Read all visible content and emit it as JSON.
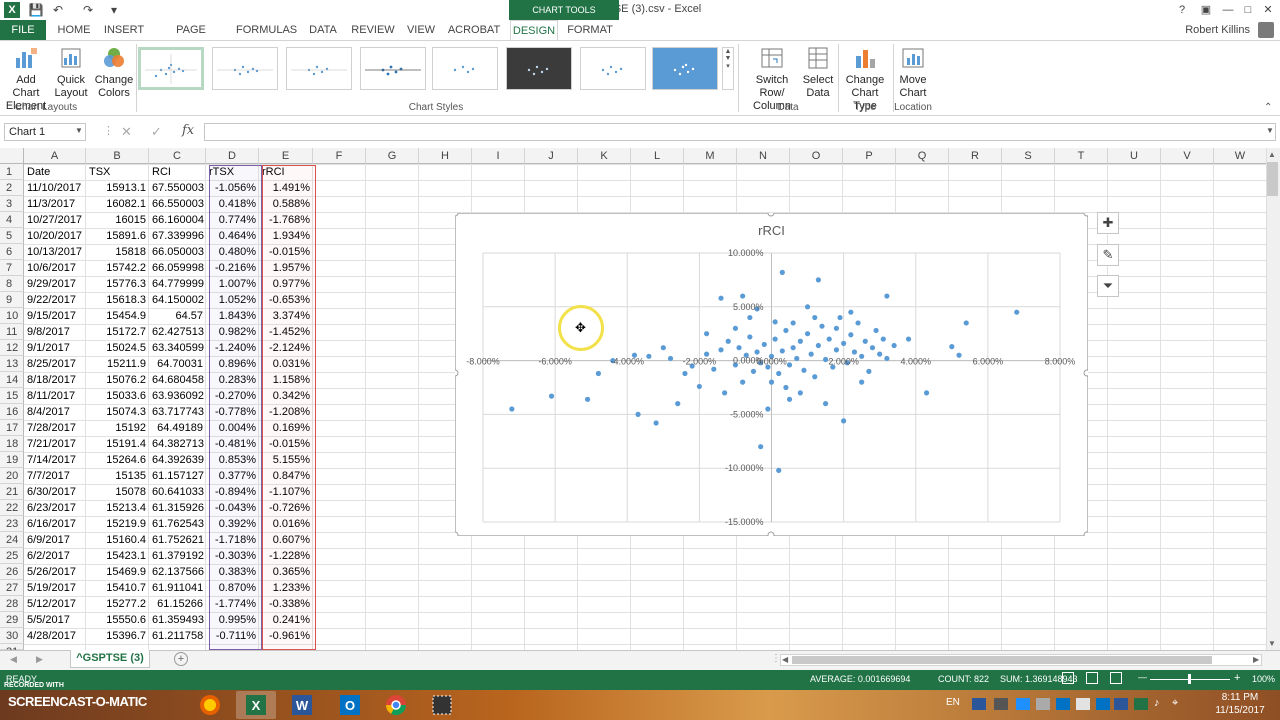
{
  "window": {
    "title": "^GSPTSE (3).csv - Excel",
    "context_tab_group": "CHART TOOLS",
    "help": "?",
    "minimize": "—",
    "restore": "□",
    "close": "✕"
  },
  "tabs": [
    "FILE",
    "HOME",
    "INSERT",
    "PAGE LAYOUT",
    "FORMULAS",
    "DATA",
    "REVIEW",
    "VIEW",
    "ACROBAT",
    "DESIGN",
    "FORMAT"
  ],
  "active_tab": "DESIGN",
  "user": "Robert Killins",
  "ribbon": {
    "add_chart_element": "Add Chart Element",
    "quick_layout": "Quick Layout",
    "change_colors": "Change Colors",
    "switch_row_column": "Switch Row/ Column",
    "select_data": "Select Data",
    "change_chart_type": "Change Chart Type",
    "move_chart": "Move Chart",
    "groups": {
      "chart_layouts": "Chart Layouts",
      "chart_styles": "Chart Styles",
      "data": "Data",
      "type": "Type",
      "location": "Location"
    }
  },
  "formula_bar": {
    "name_box": "Chart 1",
    "fx": "fx",
    "value": ""
  },
  "columns": [
    "A",
    "B",
    "C",
    "D",
    "E",
    "F",
    "G",
    "H",
    "I",
    "J",
    "K",
    "L",
    "M",
    "N",
    "O",
    "P",
    "Q",
    "R",
    "S",
    "T",
    "U",
    "V",
    "W"
  ],
  "rows": [
    [
      "Date",
      "TSX",
      "RCI",
      "rTSX",
      "rRCI"
    ],
    [
      "11/10/2017",
      "15913.1",
      "67.550003",
      "-1.056%",
      "1.491%"
    ],
    [
      "11/3/2017",
      "16082.1",
      "66.550003",
      "0.418%",
      "0.588%"
    ],
    [
      "10/27/2017",
      "16015",
      "66.160004",
      "0.774%",
      "-1.768%"
    ],
    [
      "10/20/2017",
      "15891.6",
      "67.339996",
      "0.464%",
      "1.934%"
    ],
    [
      "10/13/2017",
      "15818",
      "66.050003",
      "0.480%",
      "-0.015%"
    ],
    [
      "10/6/2017",
      "15742.2",
      "66.059998",
      "-0.216%",
      "1.957%"
    ],
    [
      "9/29/2017",
      "15776.3",
      "64.779999",
      "1.007%",
      "0.977%"
    ],
    [
      "9/22/2017",
      "15618.3",
      "64.150002",
      "1.052%",
      "-0.653%"
    ],
    [
      "9/15/2017",
      "15454.9",
      "64.57",
      "1.843%",
      "3.374%"
    ],
    [
      "9/8/2017",
      "15172.7",
      "62.427513",
      "0.982%",
      "-1.452%"
    ],
    [
      "9/1/2017",
      "15024.5",
      "63.340599",
      "-1.240%",
      "-2.124%"
    ],
    [
      "8/25/2017",
      "15211.9",
      "64.70031",
      "0.896%",
      "0.031%"
    ],
    [
      "8/18/2017",
      "15076.2",
      "64.680458",
      "0.283%",
      "1.158%"
    ],
    [
      "8/11/2017",
      "15033.6",
      "63.936092",
      "-0.270%",
      "0.342%"
    ],
    [
      "8/4/2017",
      "15074.3",
      "63.717743",
      "-0.778%",
      "-1.208%"
    ],
    [
      "7/28/2017",
      "15192",
      "64.49189",
      "0.004%",
      "0.169%"
    ],
    [
      "7/21/2017",
      "15191.4",
      "64.382713",
      "-0.481%",
      "-0.015%"
    ],
    [
      "7/14/2017",
      "15264.6",
      "64.392639",
      "0.853%",
      "5.155%"
    ],
    [
      "7/7/2017",
      "15135",
      "61.157127",
      "0.377%",
      "0.847%"
    ],
    [
      "6/30/2017",
      "15078",
      "60.641033",
      "-0.894%",
      "-1.107%"
    ],
    [
      "6/23/2017",
      "15213.4",
      "61.315926",
      "-0.043%",
      "-0.726%"
    ],
    [
      "6/16/2017",
      "15219.9",
      "61.762543",
      "0.392%",
      "0.016%"
    ],
    [
      "6/9/2017",
      "15160.4",
      "61.752621",
      "-1.718%",
      "0.607%"
    ],
    [
      "6/2/2017",
      "15423.1",
      "61.379192",
      "-0.303%",
      "-1.228%"
    ],
    [
      "5/26/2017",
      "15469.9",
      "62.137566",
      "0.383%",
      "0.365%"
    ],
    [
      "5/19/2017",
      "15410.7",
      "61.911041",
      "0.870%",
      "1.233%"
    ],
    [
      "5/12/2017",
      "15277.2",
      "61.15266",
      "-1.774%",
      "-0.338%"
    ],
    [
      "5/5/2017",
      "15550.6",
      "61.359493",
      "0.995%",
      "0.241%"
    ],
    [
      "4/28/2017",
      "15396.7",
      "61.211758",
      "-0.711%",
      "-0.961%"
    ]
  ],
  "chart_data": {
    "type": "scatter",
    "title": "rRCI",
    "xlabel": "",
    "ylabel": "",
    "xlim": [
      -0.08,
      0.08
    ],
    "ylim": [
      -0.15,
      0.1
    ],
    "x_ticks": [
      "-8.000%",
      "-6.000%",
      "-4.000%",
      "-2.000%",
      "0.000%",
      "2.000%",
      "4.000%",
      "6.000%",
      "8.000%"
    ],
    "y_ticks": [
      "10.000%",
      "5.000%",
      "0.000%",
      "-5.000%",
      "-10.000%",
      "-15.000%"
    ],
    "grid": true,
    "color": "#5b9bd5",
    "points": [
      [
        -0.072,
        -0.045
      ],
      [
        -0.061,
        -0.033
      ],
      [
        -0.051,
        -0.036
      ],
      [
        -0.048,
        -0.012
      ],
      [
        -0.044,
        0.0
      ],
      [
        -0.038,
        0.005
      ],
      [
        -0.034,
        0.004
      ],
      [
        -0.03,
        0.012
      ],
      [
        -0.028,
        0.002
      ],
      [
        -0.037,
        -0.05
      ],
      [
        -0.032,
        -0.058
      ],
      [
        -0.026,
        -0.04
      ],
      [
        -0.024,
        -0.012
      ],
      [
        -0.02,
        -0.024
      ],
      [
        -0.018,
        0.006
      ],
      [
        -0.016,
        -0.008
      ],
      [
        -0.014,
        0.01
      ],
      [
        -0.013,
        -0.03
      ],
      [
        -0.012,
        0.018
      ],
      [
        -0.01,
        -0.004
      ],
      [
        -0.009,
        0.012
      ],
      [
        -0.008,
        -0.02
      ],
      [
        -0.007,
        0.005
      ],
      [
        -0.006,
        0.022
      ],
      [
        -0.005,
        -0.01
      ],
      [
        -0.004,
        0.008
      ],
      [
        -0.003,
        -0.002
      ],
      [
        -0.002,
        0.015
      ],
      [
        -0.001,
        -0.006
      ],
      [
        0.0,
        0.004
      ],
      [
        0.001,
        0.02
      ],
      [
        0.002,
        -0.012
      ],
      [
        0.003,
        0.009
      ],
      [
        0.004,
        0.028
      ],
      [
        0.005,
        -0.004
      ],
      [
        0.006,
        0.012
      ],
      [
        0.007,
        0.002
      ],
      [
        0.008,
        0.018
      ],
      [
        0.009,
        -0.009
      ],
      [
        0.01,
        0.025
      ],
      [
        0.011,
        0.006
      ],
      [
        0.012,
        -0.015
      ],
      [
        0.013,
        0.014
      ],
      [
        0.014,
        0.032
      ],
      [
        0.015,
        0.001
      ],
      [
        0.016,
        0.02
      ],
      [
        0.017,
        -0.006
      ],
      [
        0.018,
        0.01
      ],
      [
        0.019,
        0.04
      ],
      [
        0.02,
        0.016
      ],
      [
        0.021,
        -0.002
      ],
      [
        0.022,
        0.024
      ],
      [
        0.023,
        0.008
      ],
      [
        0.024,
        0.035
      ],
      [
        0.025,
        0.004
      ],
      [
        0.026,
        0.018
      ],
      [
        0.027,
        -0.01
      ],
      [
        0.028,
        0.012
      ],
      [
        0.029,
        0.028
      ],
      [
        0.03,
        0.006
      ],
      [
        0.031,
        0.02
      ],
      [
        0.032,
        0.002
      ],
      [
        0.034,
        0.014
      ],
      [
        0.038,
        0.02
      ],
      [
        0.043,
        -0.03
      ],
      [
        0.05,
        0.013
      ],
      [
        0.052,
        0.005
      ],
      [
        0.054,
        0.035
      ],
      [
        0.068,
        0.045
      ],
      [
        0.003,
        0.082
      ],
      [
        0.013,
        0.075
      ],
      [
        -0.014,
        0.058
      ],
      [
        -0.008,
        0.06
      ],
      [
        0.005,
        -0.036
      ],
      [
        -0.003,
        -0.08
      ],
      [
        0.002,
        -0.102
      ],
      [
        0.02,
        -0.056
      ],
      [
        0.032,
        0.06
      ],
      [
        0.015,
        -0.04
      ],
      [
        -0.001,
        -0.045
      ],
      [
        0.008,
        -0.03
      ],
      [
        -0.006,
        0.04
      ],
      [
        0.01,
        0.05
      ],
      [
        0.022,
        0.045
      ],
      [
        0.006,
        0.035
      ],
      [
        -0.01,
        0.03
      ],
      [
        -0.018,
        0.025
      ],
      [
        -0.022,
        -0.005
      ],
      [
        0.0,
        -0.02
      ],
      [
        0.004,
        -0.025
      ],
      [
        0.012,
        0.04
      ],
      [
        0.018,
        0.03
      ],
      [
        0.025,
        -0.02
      ],
      [
        -0.004,
        0.048
      ],
      [
        0.001,
        0.036
      ]
    ]
  },
  "sheet_tab": "^GSPTSE (3)",
  "status": {
    "ready": "READY",
    "average": "AVERAGE: 0.001669694",
    "count": "COUNT: 822",
    "sum": "SUM: 1.369148943",
    "zoom": "100%"
  },
  "taskbar": {
    "screencast_small": "RECORDED WITH",
    "screencast_big": "SCREENCAST-O-MATIC",
    "lang": "EN",
    "time": "8:11 PM",
    "date": "11/15/2017"
  }
}
